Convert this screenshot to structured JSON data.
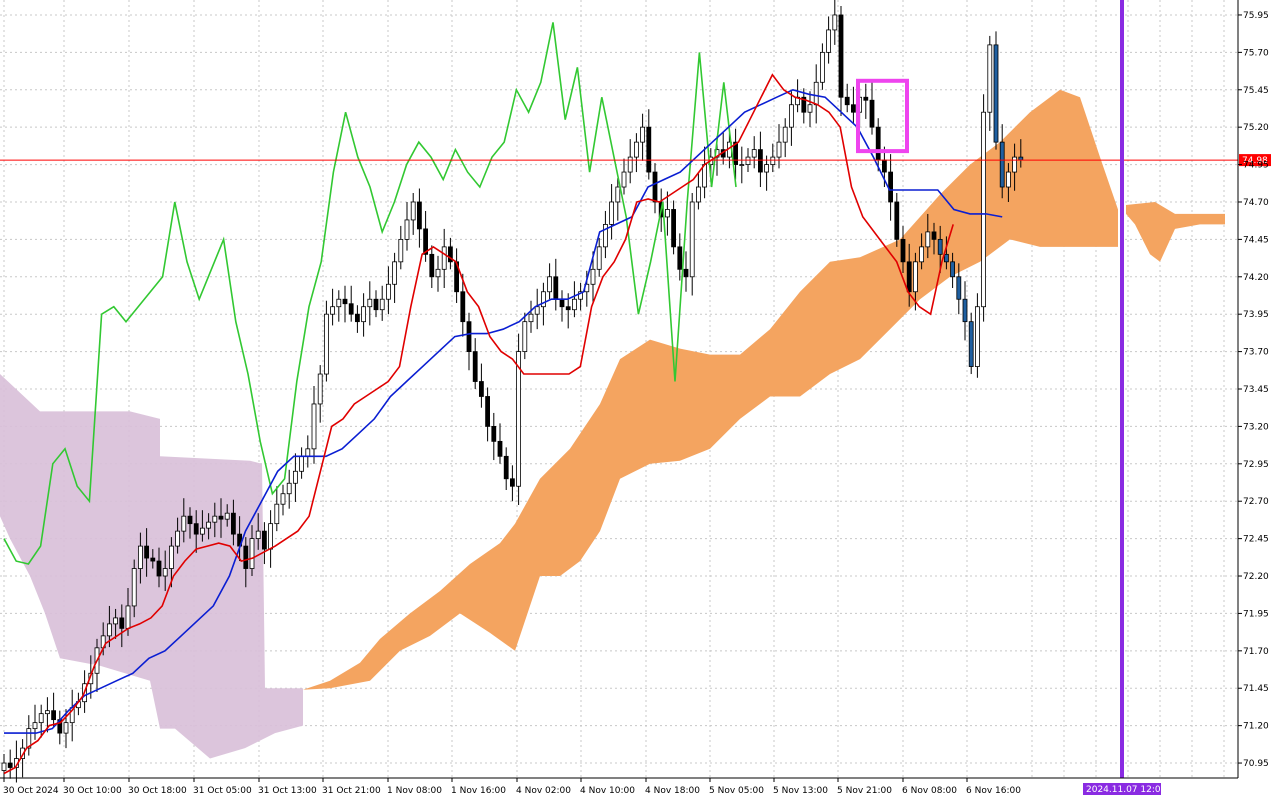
{
  "chart_data": {
    "type": "candlestick",
    "indicator": "Ichimoku Kinko Hyo",
    "price_axis": {
      "ticks": [
        "75.95",
        "75.70",
        "75.45",
        "75.20",
        "74.95",
        "74.70",
        "74.45",
        "74.20",
        "73.95",
        "73.70",
        "73.45",
        "73.20",
        "72.95",
        "72.70",
        "72.45",
        "72.20",
        "71.95",
        "71.70",
        "71.45",
        "71.20",
        "70.95"
      ],
      "ylim": [
        70.85,
        76.05
      ],
      "current_price_label": "74.98",
      "current_price": 74.98
    },
    "time_axis": {
      "ticks": [
        "30 Oct 2024",
        "30 Oct 10:00",
        "30 Oct 18:00",
        "31 Oct 05:00",
        "31 Oct 13:00",
        "31 Oct 21:00",
        "1 Nov 08:00",
        "1 Nov 16:00",
        "4 Nov 02:00",
        "4 Nov 10:00",
        "4 Nov 18:00",
        "5 Nov 05:00",
        "5 Nov 13:00",
        "5 Nov 21:00",
        "6 Nov 08:00",
        "6 Nov 16:00"
      ],
      "marker_label": "2024.11.07 12:00"
    },
    "colors": {
      "tenkan": "#e00000",
      "kijun": "#0a1ed2",
      "chikou": "#32c832",
      "kumo_bull": "#f4a460",
      "kumo_bear": "#d8bfd8",
      "current_price_line": "#ff0000",
      "vertical_marker": "#8a2be2",
      "highlight_box": "#ee44ee",
      "bull_candle": "#ffffff",
      "bear_candle": "#000000"
    },
    "series": {
      "close": [
        70.95,
        70.92,
        70.98,
        71.05,
        71.18,
        71.22,
        71.28,
        71.3,
        71.24,
        71.15,
        71.22,
        71.32,
        71.36,
        71.48,
        71.55,
        71.72,
        71.8,
        71.88,
        71.92,
        71.85,
        72.0,
        72.25,
        72.4,
        72.32,
        72.3,
        72.2,
        72.25,
        72.4,
        72.5,
        72.6,
        72.55,
        72.48,
        72.52,
        72.56,
        72.6,
        72.58,
        72.62,
        72.48,
        72.4,
        72.25,
        72.45,
        72.5,
        72.38,
        72.55,
        72.68,
        72.75,
        72.82,
        72.9,
        73.0,
        73.05,
        73.35,
        73.55,
        73.95,
        74.0,
        74.05,
        74.02,
        73.95,
        73.9,
        74.0,
        74.05,
        73.98,
        74.05,
        74.15,
        74.3,
        74.45,
        74.58,
        74.7,
        74.52,
        74.35,
        74.2,
        74.25,
        74.4,
        74.3,
        74.1,
        73.9,
        73.7,
        73.5,
        73.4,
        73.2,
        73.1,
        73.0,
        72.85,
        72.8,
        73.7,
        73.9,
        73.95,
        74.0,
        74.1,
        74.2,
        74.05,
        74.0,
        73.98,
        74.05,
        74.1,
        74.15,
        74.25,
        74.4,
        74.55,
        74.7,
        74.8,
        74.9,
        75.0,
        75.1,
        75.2,
        74.9,
        74.7,
        74.6,
        74.65,
        74.4,
        74.25,
        74.2,
        74.7,
        74.8,
        74.95,
        75.0,
        75.05,
        75.0,
        75.1,
        74.95,
        74.95,
        75.0,
        75.05,
        74.9,
        74.95,
        75.0,
        75.1,
        75.2,
        75.35,
        75.4,
        75.3,
        75.35,
        75.5,
        75.7,
        75.85,
        75.95,
        75.4,
        75.35,
        75.3,
        75.4,
        75.38,
        75.2,
        74.98,
        74.9,
        74.7,
        74.45,
        74.3,
        74.1,
        74.3,
        74.4,
        74.5,
        74.45,
        74.35,
        74.3,
        74.2,
        74.05,
        73.9,
        73.6,
        74.0,
        75.3,
        75.75,
        75.1,
        74.8,
        74.9,
        75.0,
        74.98
      ],
      "tenkan": [
        70.88,
        70.92,
        71.05,
        71.1,
        71.2,
        71.22,
        71.3,
        71.4,
        71.6,
        71.75,
        71.8,
        71.85,
        71.88,
        71.92,
        72.0,
        72.2,
        72.3,
        72.38,
        72.4,
        72.42,
        72.4,
        72.3,
        72.32,
        72.36,
        72.4,
        72.45,
        72.5,
        72.6,
        72.9,
        73.2,
        73.25,
        73.35,
        73.4,
        73.45,
        73.5,
        73.6,
        74.0,
        74.35,
        74.4,
        74.35,
        74.3,
        74.1,
        74.0,
        73.8,
        73.7,
        73.65,
        73.55,
        73.55,
        73.55,
        73.55,
        73.55,
        73.6,
        74.0,
        74.2,
        74.3,
        74.45,
        74.7,
        74.72,
        74.7,
        74.75,
        74.8,
        74.85,
        74.95,
        75.0,
        75.05,
        75.1,
        75.25,
        75.4,
        75.55,
        75.45,
        75.4,
        75.38,
        75.35,
        75.3,
        75.2,
        74.8,
        74.6,
        74.5,
        74.4,
        74.3,
        74.1,
        74.0,
        73.95,
        74.3,
        74.55
      ],
      "kijun": [
        71.15,
        71.15,
        71.15,
        71.18,
        71.3,
        71.4,
        71.45,
        71.5,
        71.55,
        71.65,
        71.7,
        71.8,
        71.9,
        72.0,
        72.2,
        72.5,
        72.7,
        72.9,
        73.0,
        73.0,
        73.0,
        73.05,
        73.15,
        73.25,
        73.4,
        73.5,
        73.6,
        73.7,
        73.8,
        73.82,
        73.82,
        73.85,
        73.9,
        74.0,
        74.05,
        74.05,
        74.1,
        74.5,
        74.55,
        74.6,
        74.8,
        74.85,
        74.9,
        75.0,
        75.1,
        75.2,
        75.3,
        75.35,
        75.4,
        75.45,
        75.42,
        75.4,
        75.3,
        75.2,
        75.0,
        74.78,
        74.78,
        74.78,
        74.78,
        74.65,
        74.62,
        74.62,
        74.6
      ],
      "chikou": [
        72.45,
        72.3,
        72.28,
        72.4,
        72.95,
        73.05,
        72.8,
        72.7,
        73.95,
        74.0,
        73.9,
        74.0,
        74.1,
        74.2,
        74.7,
        74.3,
        74.05,
        74.25,
        74.45,
        73.9,
        73.55,
        73.1,
        72.75,
        72.85,
        73.5,
        74.0,
        74.3,
        74.9,
        75.3,
        75.0,
        74.8,
        74.5,
        74.7,
        74.95,
        75.1,
        75.0,
        74.85,
        75.05,
        74.9,
        74.8,
        75.0,
        75.1,
        75.45,
        75.3,
        75.5,
        75.9,
        75.25,
        75.6,
        74.9,
        75.4,
        75.0,
        74.6,
        73.95,
        74.3,
        74.7,
        73.5,
        74.7,
        75.7,
        74.8,
        75.5,
        74.8
      ]
    }
  }
}
